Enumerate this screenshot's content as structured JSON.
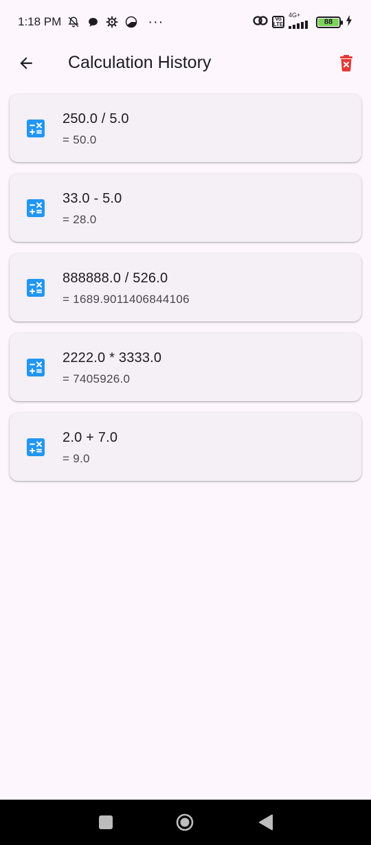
{
  "status_bar": {
    "time": "1:18 PM",
    "more": "···",
    "network": "4G+",
    "volte": "Vo LTE",
    "battery_level": "88",
    "battery_fill_color": "#7ad35a"
  },
  "app_bar": {
    "title": "Calculation History",
    "back_icon": "arrow-left-icon",
    "delete_icon": "trash-x-icon",
    "delete_color": "#e53935"
  },
  "history": [
    {
      "expression": "250.0 / 5.0",
      "result": "= 50.0"
    },
    {
      "expression": "33.0 - 5.0",
      "result": "= 28.0"
    },
    {
      "expression": "888888.0 / 526.0",
      "result": "= 1689.9011406844106"
    },
    {
      "expression": "2222.0 * 3333.0",
      "result": "= 7405926.0"
    },
    {
      "expression": "2.0 + 7.0",
      "result": "= 9.0"
    }
  ],
  "colors": {
    "accent": "#2196f3",
    "background": "#fdf7fd",
    "card": "#f4f0f5"
  },
  "nav_bar": {
    "recents_icon": "square-icon",
    "home_icon": "circle-icon",
    "back_icon": "triangle-back-icon"
  }
}
